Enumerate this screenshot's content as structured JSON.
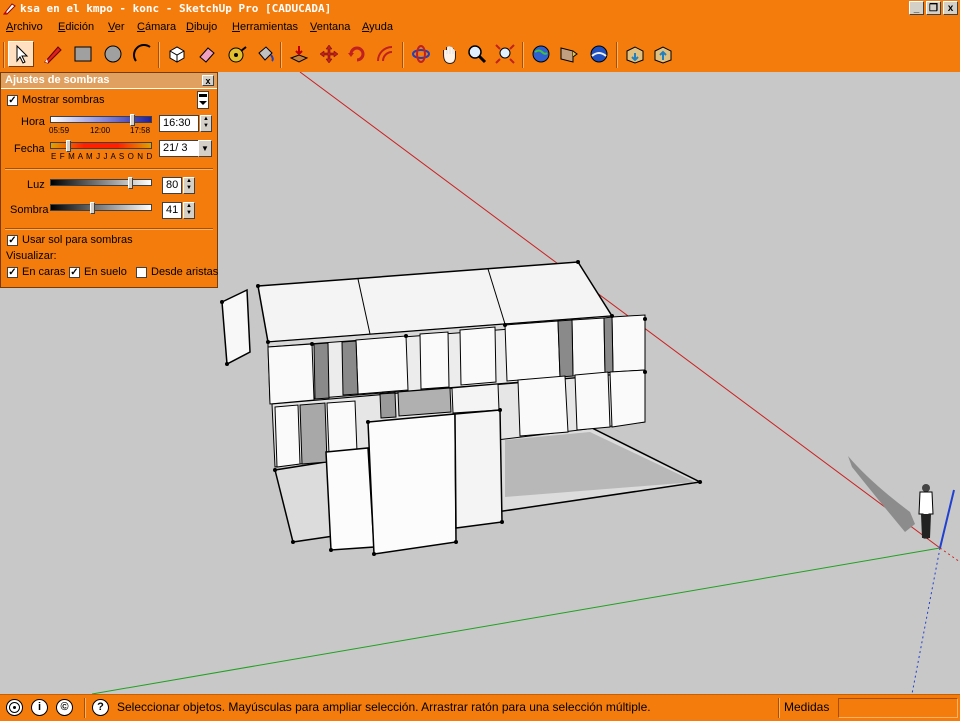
{
  "window": {
    "title": "ksa en el kmpo - konc - SketchUp Pro [CADUCADA]",
    "minimize": "_",
    "restore": "❐",
    "close": "x"
  },
  "menu": [
    "Archivo",
    "Edición",
    "Ver",
    "Cámara",
    "Dibujo",
    "Herramientas",
    "Ventana",
    "Ayuda"
  ],
  "toolbar": {
    "icons": [
      "select-icon",
      "pencil-icon",
      "rectangle-icon",
      "circle-icon",
      "arc-icon",
      "make-component-icon",
      "eraser-icon",
      "tape-measure-icon",
      "paint-bucket-icon",
      "push-pull-icon",
      "move-icon",
      "rotate-icon",
      "offset-icon",
      "orbit-icon",
      "pan-icon",
      "zoom-icon",
      "zoom-extents-icon",
      "get-models-icon",
      "share-model-icon",
      "google-earth-icon",
      "warehouse-icon",
      "share-component-icon"
    ]
  },
  "shadow_panel": {
    "title": "Ajustes de sombras",
    "close": "x",
    "show_shadows": {
      "label": "Mostrar sombras",
      "checked": true
    },
    "hour": {
      "label": "Hora",
      "min": "05:59",
      "mid": "12:00",
      "max": "17:58",
      "value": "16:30",
      "position": 0.82
    },
    "date": {
      "label": "Fecha",
      "months": "E F M A M J J A S O N D",
      "value": "21/ 3",
      "position": 0.17
    },
    "light": {
      "label": "Luz",
      "value": "80",
      "position": 0.8
    },
    "shade": {
      "label": "Sombra",
      "value": "41",
      "position": 0.41
    },
    "use_sun": {
      "label": "Usar sol para sombras",
      "checked": true
    },
    "display_label": "Visualizar:",
    "on_faces": {
      "label": "En caras",
      "checked": true
    },
    "on_ground": {
      "label": "En suelo",
      "checked": true
    },
    "from_edges": {
      "label": "Desde aristas",
      "checked": false
    }
  },
  "status": {
    "message": "Seleccionar objetos. Mayúsculas para ampliar selección. Arrastrar ratón para una selección múltiple.",
    "measure_label": "Medidas",
    "measure_value": "",
    "help_glyph": "?",
    "info_glyph": "i",
    "credits_glyph": "©"
  },
  "colors": {
    "accent": "#f47c0c",
    "viewport": "#c8c8c8",
    "red_axis": "#cc2020",
    "green_axis": "#20a020",
    "blue_axis": "#2040d0"
  }
}
